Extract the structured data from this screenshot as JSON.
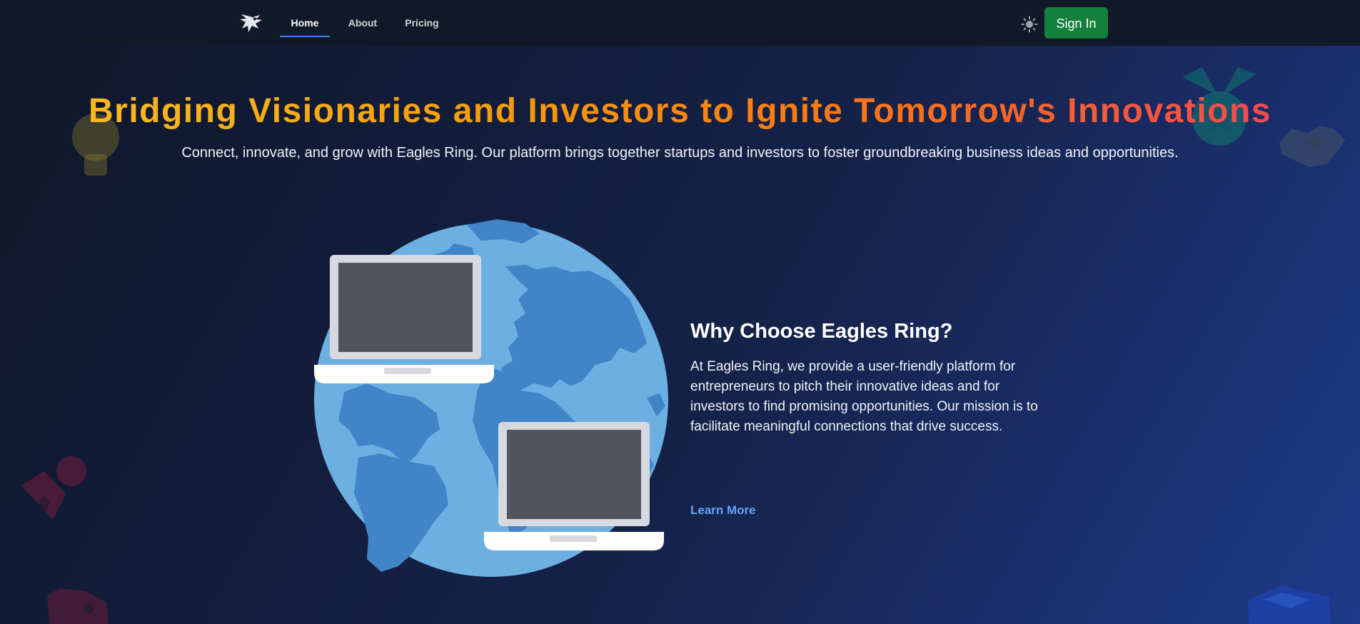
{
  "navbar": {
    "logo_icon": "eagle-logo-icon",
    "links": [
      {
        "label": "Home",
        "active": true
      },
      {
        "label": "About",
        "active": false
      },
      {
        "label": "Pricing",
        "active": false
      }
    ],
    "theme_toggle_icon": "sun-icon",
    "signin_label": "Sign In"
  },
  "hero": {
    "title": "Bridging Visionaries and Investors to Ignite Tomorrow's Innovations",
    "subtitle": "Connect, innovate, and grow with Eagles Ring. Our platform brings together startups and investors to foster groundbreaking business ideas and opportunities.",
    "illustration_icon": "globe-laptops-illustration",
    "decorations": [
      "lightbulb-icon",
      "badge-check-icon",
      "handshake-icon",
      "user-tie-icon",
      "rocket-icon",
      "cube-icon"
    ]
  },
  "feature": {
    "heading": "Why Choose Eagles Ring?",
    "text": "At Eagles Ring, we provide a user-friendly platform for entrepreneurs to pitch their innovative ideas and for investors to find promising opportunities. Our mission is to facilitate meaningful connections that drive success.",
    "learn_more_label": "Learn More"
  },
  "colors": {
    "nav_bg": "#111827",
    "signin_bg": "#15803d",
    "link_accent": "#60a5fa",
    "active_underline": "#3b82f6",
    "title_gradient": [
      "#fbbf24",
      "#f97316",
      "#f43f5e"
    ]
  }
}
